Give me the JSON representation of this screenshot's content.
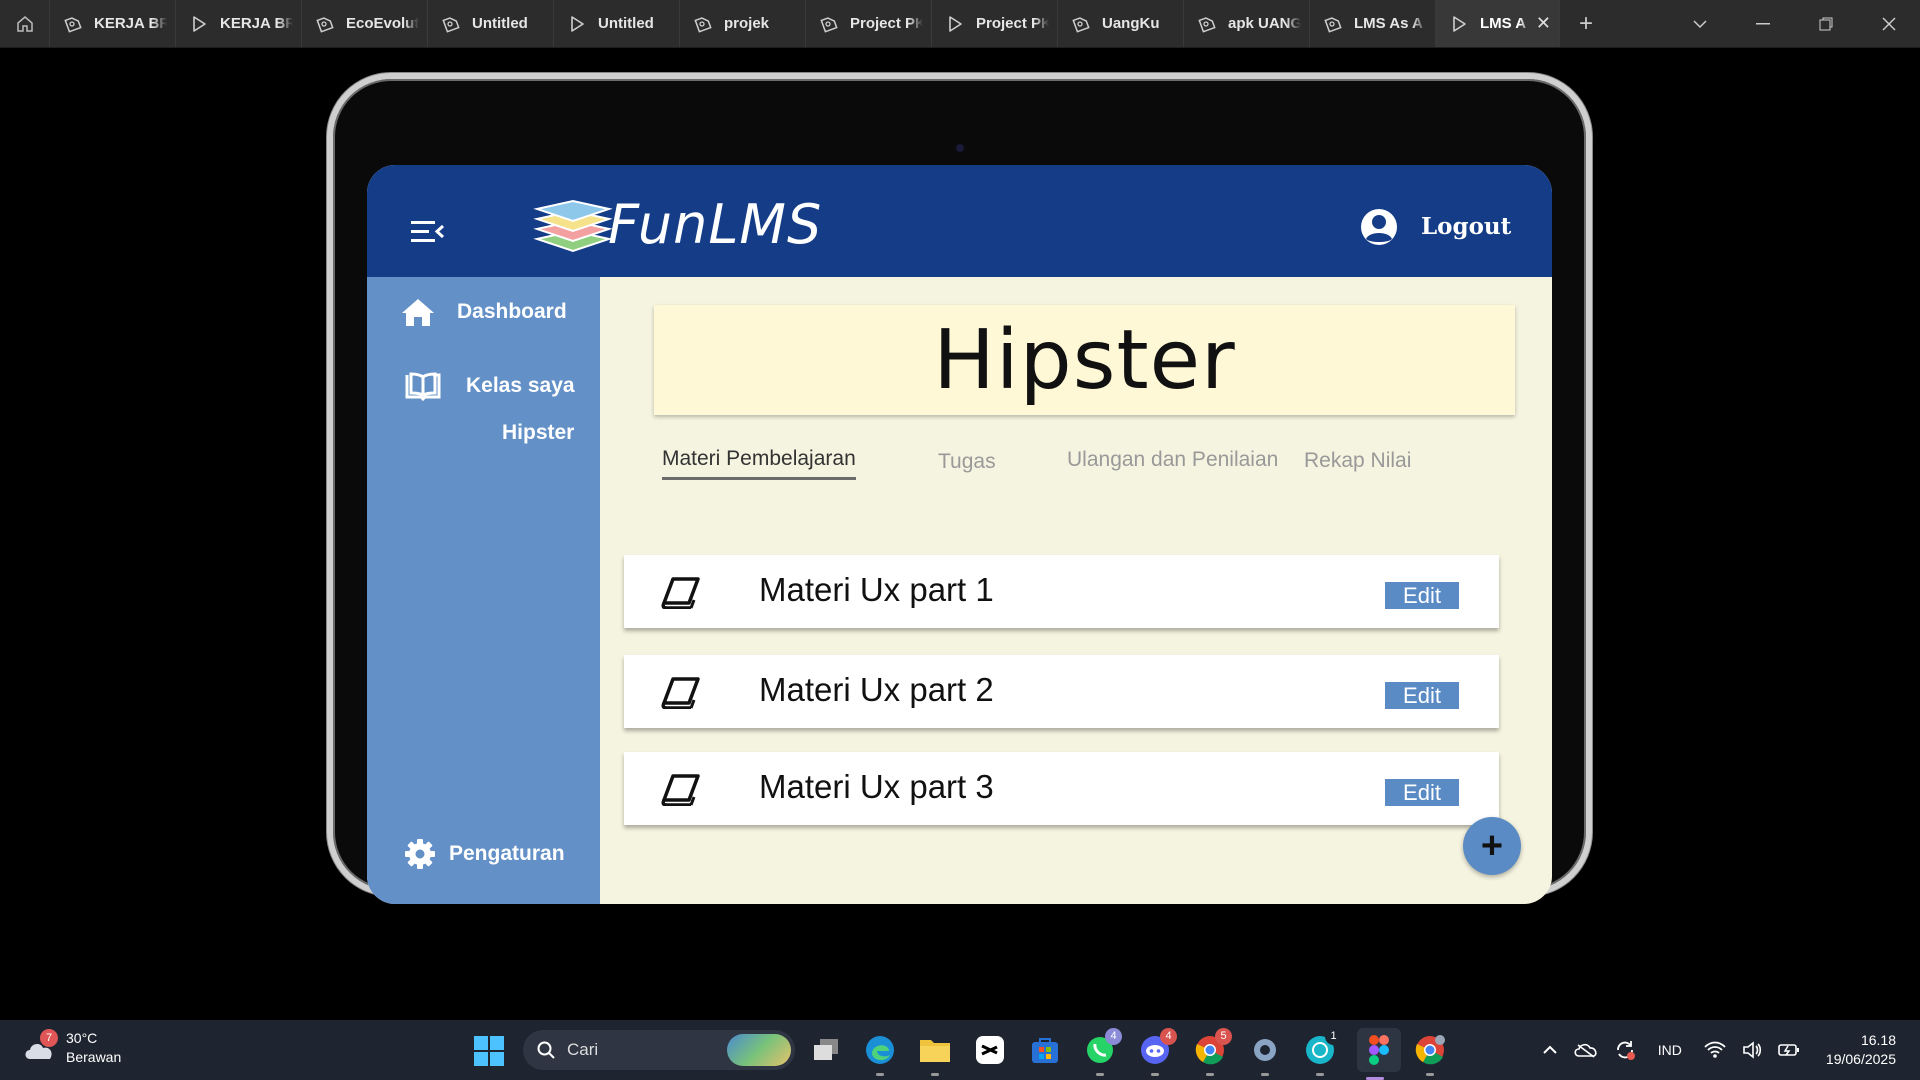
{
  "tabbar": {
    "tabs": [
      {
        "label": "KERJA BR",
        "icon": "figma-file-icon"
      },
      {
        "label": "KERJA BR",
        "icon": "prototype-play-icon"
      },
      {
        "label": "EcoEvoluti",
        "icon": "figma-file-icon"
      },
      {
        "label": "Untitled",
        "icon": "figma-file-icon"
      },
      {
        "label": "Untitled",
        "icon": "prototype-play-icon"
      },
      {
        "label": "projek",
        "icon": "figma-file-icon"
      },
      {
        "label": "Project PK",
        "icon": "figma-file-icon"
      },
      {
        "label": "Project PK",
        "icon": "prototype-play-icon"
      },
      {
        "label": "UangKu",
        "icon": "figma-file-icon"
      },
      {
        "label": "apk UANG",
        "icon": "figma-file-icon"
      },
      {
        "label": "LMS As A",
        "icon": "figma-file-icon"
      },
      {
        "label": "LMS A",
        "icon": "prototype-play-icon",
        "active": true
      }
    ]
  },
  "app": {
    "brand": "FunLMS",
    "logout_label": "Logout",
    "sidebar": {
      "dashboard": "Dashboard",
      "kelas": "Kelas saya",
      "kelas_sub": "Hipster",
      "settings": "Pengaturan"
    },
    "course_title": "Hipster",
    "tabs": [
      "Materi Pembelajaran",
      "Tugas",
      "Ulangan dan Penilaian",
      "Rekap Nilai"
    ],
    "materials": [
      {
        "title": "Materi Ux part 1",
        "action": "Edit"
      },
      {
        "title": "Materi Ux part 2",
        "action": "Edit"
      },
      {
        "title": "Materi Ux part 3",
        "action": "Edit"
      }
    ],
    "fab_label": "+"
  },
  "taskbar": {
    "weather": {
      "temp": "30°C",
      "desc": "Berawan",
      "badge": "7"
    },
    "search_placeholder": "Cari",
    "badges": {
      "whatsapp": "4",
      "discord": "4",
      "chrome": "5",
      "canva": "1"
    },
    "language": "IND",
    "time": "16.18",
    "date": "19/06/2025"
  },
  "colors": {
    "header": "#153d87",
    "sidebar": "#6390c7",
    "content_bg": "#f5f4e0",
    "title_card": "#fff8d6",
    "accent_button": "#5a8bc4"
  }
}
